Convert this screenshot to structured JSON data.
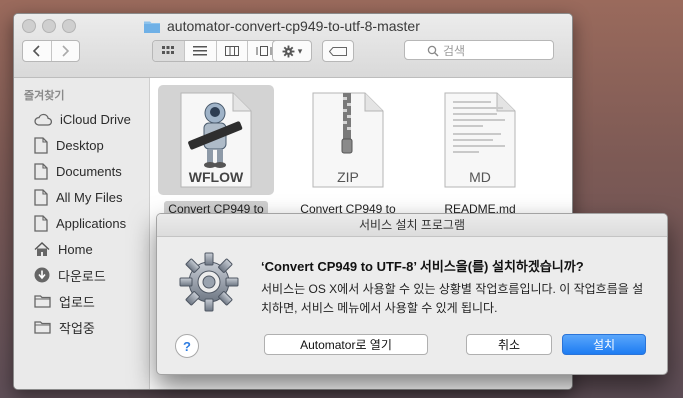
{
  "window": {
    "title": "automator-convert-cp949-to-utf-8-master"
  },
  "toolbar": {
    "back_icon": "chevron-left-icon",
    "forward_icon": "chevron-right-icon",
    "view_icons": [
      "icon-view-icon",
      "list-view-icon",
      "column-view-icon",
      "cover-flow-icon"
    ],
    "gear_caret": "▾",
    "search_placeholder": "검색"
  },
  "sidebar": {
    "header": "즐겨찾기",
    "items": [
      {
        "label": "iCloud Drive",
        "icon": "cloud-icon"
      },
      {
        "label": "Desktop",
        "icon": "document-icon"
      },
      {
        "label": "Documents",
        "icon": "document-icon"
      },
      {
        "label": "All My Files",
        "icon": "document-icon"
      },
      {
        "label": "Applications",
        "icon": "document-icon"
      },
      {
        "label": "Home",
        "icon": "home-icon"
      },
      {
        "label": "다운로드",
        "icon": "download-icon"
      },
      {
        "label": "업로드",
        "icon": "folder-icon"
      },
      {
        "label": "작업중",
        "icon": "folder-icon"
      }
    ]
  },
  "files": [
    {
      "name": "Convert CP949 to",
      "badge": "WFLOW",
      "selected": true
    },
    {
      "name": "Convert CP949 to",
      "badge": "ZIP",
      "selected": false
    },
    {
      "name": "README.md",
      "badge": "MD",
      "selected": false
    }
  ],
  "dialog": {
    "title": "서비스 설치 프로그램",
    "heading": "‘Convert CP949 to UTF-8’ 서비스을(를) 설치하겠습니까?",
    "body": "서비스는 OS X에서 사용할 수 있는 상황별 작업흐름입니다. 이 작업흐름을 설치하면, 서비스 메뉴에서 사용할 수 있게 됩니다.",
    "help_label": "?",
    "open_label": "Automator로 열기",
    "cancel_label": "취소",
    "install_label": "설치"
  },
  "colors": {
    "accent": "#1d7cf2",
    "sidebar_bg": "#eaeaea",
    "dialog_bg": "#ececec"
  }
}
